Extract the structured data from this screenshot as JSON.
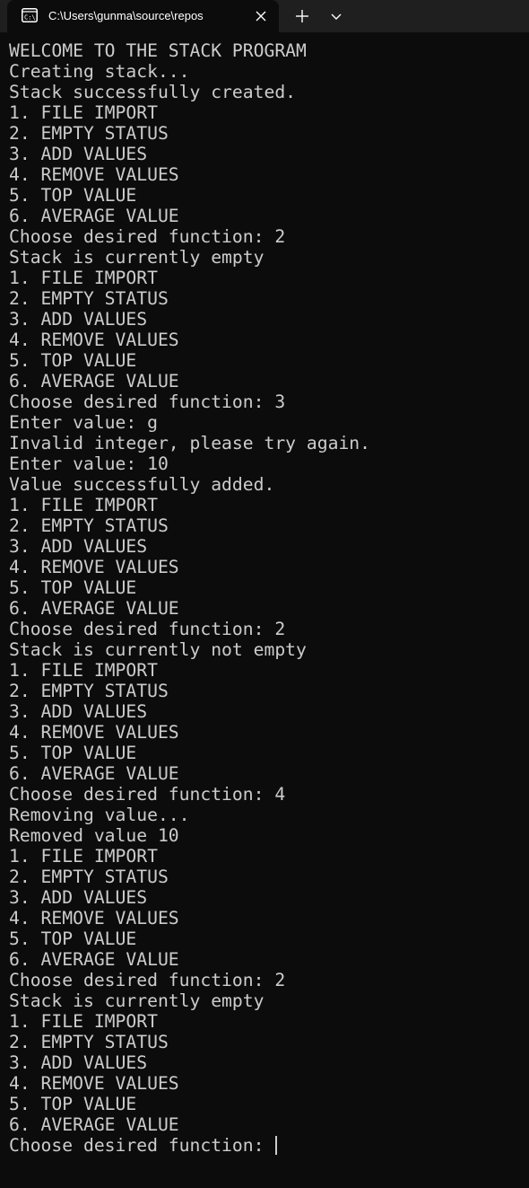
{
  "tab": {
    "title": "C:\\Users\\gunma\\source\\repos",
    "icon": "terminal-icon"
  },
  "theme": {
    "background": "#0c0c0c",
    "tabbar": "#1f1f1f",
    "foreground": "#cccccc"
  },
  "console": {
    "lines": [
      "WELCOME TO THE STACK PROGRAM",
      "Creating stack...",
      "Stack successfully created.",
      "1. FILE IMPORT",
      "2. EMPTY STATUS",
      "3. ADD VALUES",
      "4. REMOVE VALUES",
      "5. TOP VALUE",
      "6. AVERAGE VALUE",
      "Choose desired function: 2",
      "Stack is currently empty",
      "1. FILE IMPORT",
      "2. EMPTY STATUS",
      "3. ADD VALUES",
      "4. REMOVE VALUES",
      "5. TOP VALUE",
      "6. AVERAGE VALUE",
      "Choose desired function: 3",
      "Enter value: g",
      "Invalid integer, please try again.",
      "Enter value: 10",
      "Value successfully added.",
      "1. FILE IMPORT",
      "2. EMPTY STATUS",
      "3. ADD VALUES",
      "4. REMOVE VALUES",
      "5. TOP VALUE",
      "6. AVERAGE VALUE",
      "Choose desired function: 2",
      "Stack is currently not empty",
      "1. FILE IMPORT",
      "2. EMPTY STATUS",
      "3. ADD VALUES",
      "4. REMOVE VALUES",
      "5. TOP VALUE",
      "6. AVERAGE VALUE",
      "Choose desired function: 4",
      "Removing value...",
      "Removed value 10",
      "1. FILE IMPORT",
      "2. EMPTY STATUS",
      "3. ADD VALUES",
      "4. REMOVE VALUES",
      "5. TOP VALUE",
      "6. AVERAGE VALUE",
      "Choose desired function: 2",
      "Stack is currently empty",
      "1. FILE IMPORT",
      "2. EMPTY STATUS",
      "3. ADD VALUES",
      "4. REMOVE VALUES",
      "5. TOP VALUE",
      "6. AVERAGE VALUE"
    ],
    "prompt": "Choose desired function: "
  }
}
